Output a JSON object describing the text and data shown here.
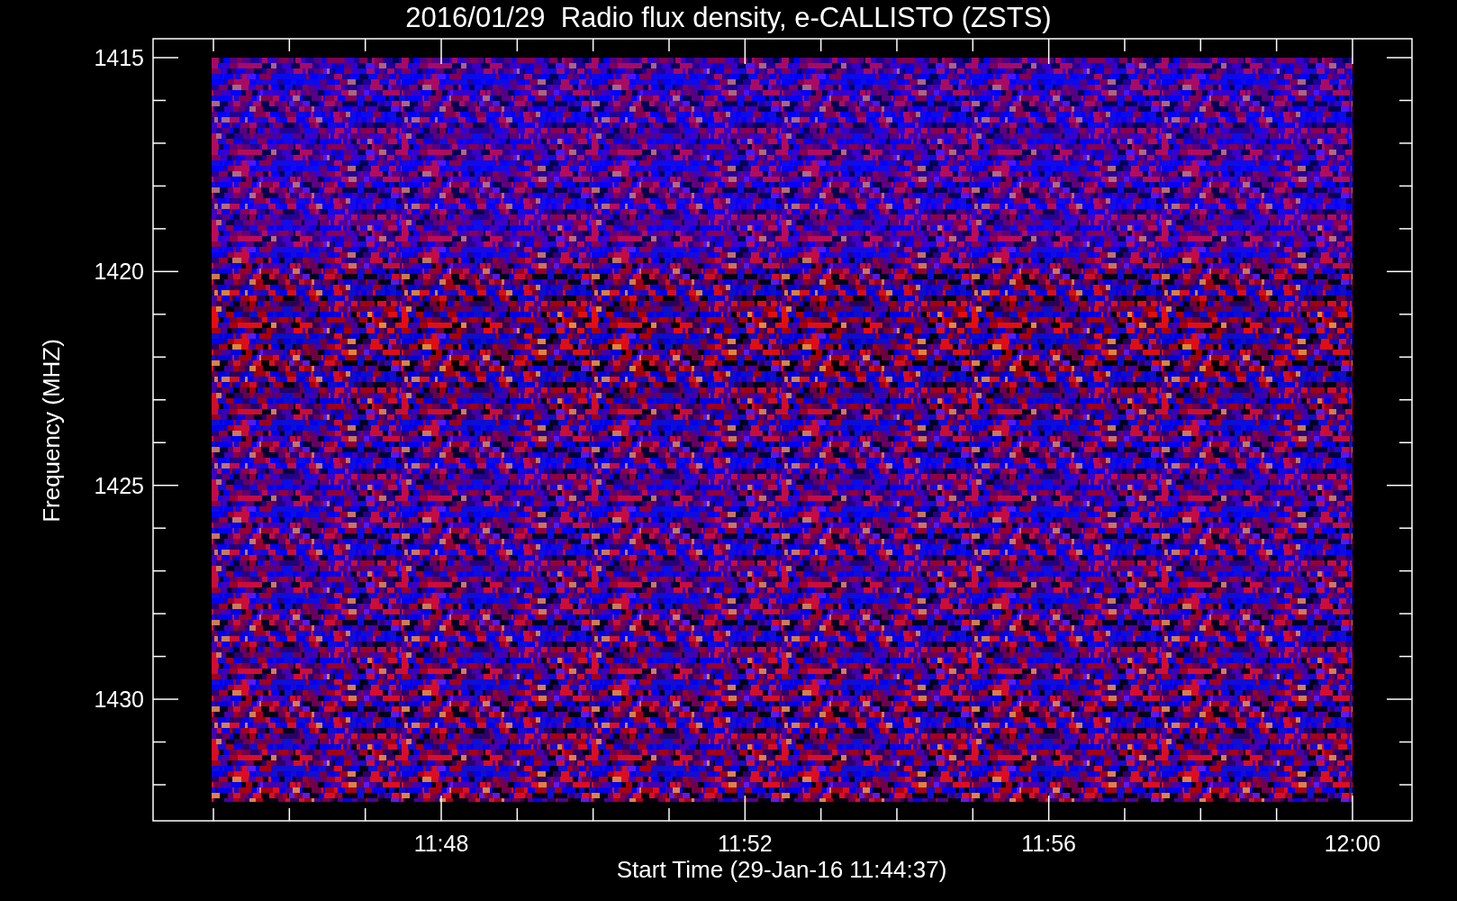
{
  "title": "2016/01/29  Radio flux density, e-CALLISTO (ZSTS)",
  "y_axis": {
    "label": "Frequency (MHZ)",
    "tick_labels": [
      "1415",
      "1420",
      "1425",
      "1430"
    ]
  },
  "x_axis": {
    "label": "Start Time (29-Jan-16 11:44:37)",
    "tick_labels": [
      "11:48",
      "11:52",
      "11:56",
      "12:00"
    ]
  }
}
